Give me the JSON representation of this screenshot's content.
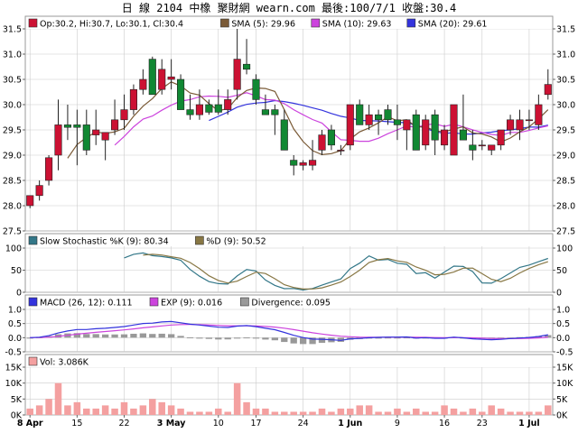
{
  "header": {
    "title_parts": [
      "日",
      "線",
      "2104",
      "中橡",
      "聚財網",
      "wearn.com",
      "最後:100/7/1",
      "收盤:30.4"
    ]
  },
  "colors": {
    "up": "#cc1133",
    "down": "#118833",
    "sma5": "#7a5a36",
    "sma10": "#cc44dd",
    "sma20": "#3333dd",
    "stoch_k": "#337788",
    "stoch_d": "#887744",
    "macd": "#3333dd",
    "exp": "#cc44dd",
    "divergence": "#999999",
    "volume": "#f4a0a0",
    "grid": "#cccccc"
  },
  "chart_data": [
    {
      "type": "candlestick",
      "legend": {
        "ohlc": "Op:30.2, Hi:30.7, Lo:30.1, Cl:30.4",
        "sma5": "SMA (5): 29.96",
        "sma10": "SMA (10): 29.63",
        "sma20": "SMA (20): 29.61"
      },
      "y_ticks": [
        "31.5",
        "31.0",
        "30.5",
        "30.0",
        "29.5",
        "29.0",
        "28.5",
        "28.0",
        "27.5"
      ],
      "ylim": [
        27.5,
        31.5
      ],
      "x_tick_labels": [
        {
          "label": "8 Apr",
          "idx": 0
        },
        {
          "label": "15",
          "idx": 5
        },
        {
          "label": "22",
          "idx": 10
        },
        {
          "label": "3 May",
          "idx": 15
        },
        {
          "label": "10",
          "idx": 20
        },
        {
          "label": "17",
          "idx": 24
        },
        {
          "label": "24",
          "idx": 29
        },
        {
          "label": "1 Jun",
          "idx": 34
        },
        {
          "label": "9",
          "idx": 39
        },
        {
          "label": "16",
          "idx": 44
        },
        {
          "label": "23",
          "idx": 48
        },
        {
          "label": "1 Jul",
          "idx": 53
        }
      ],
      "candles": [
        {
          "o": 28.0,
          "h": 28.2,
          "l": 27.95,
          "c": 28.2
        },
        {
          "o": 28.2,
          "h": 28.5,
          "l": 28.1,
          "c": 28.4
        },
        {
          "o": 28.5,
          "h": 29.0,
          "l": 28.4,
          "c": 28.95
        },
        {
          "o": 29.0,
          "h": 30.1,
          "l": 28.7,
          "c": 29.6
        },
        {
          "o": 29.6,
          "h": 30.0,
          "l": 29.3,
          "c": 29.55
        },
        {
          "o": 29.6,
          "h": 29.9,
          "l": 28.8,
          "c": 29.55
        },
        {
          "o": 29.6,
          "h": 29.9,
          "l": 29.0,
          "c": 29.1
        },
        {
          "o": 29.4,
          "h": 29.9,
          "l": 29.2,
          "c": 29.5
        },
        {
          "o": 29.3,
          "h": 29.4,
          "l": 28.9,
          "c": 29.45
        },
        {
          "o": 29.5,
          "h": 30.1,
          "l": 29.4,
          "c": 29.7
        },
        {
          "o": 29.7,
          "h": 30.2,
          "l": 29.5,
          "c": 29.9
        },
        {
          "o": 29.9,
          "h": 30.4,
          "l": 29.8,
          "c": 30.3
        },
        {
          "o": 30.3,
          "h": 30.7,
          "l": 30.2,
          "c": 30.5
        },
        {
          "o": 30.9,
          "h": 30.95,
          "l": 30.2,
          "c": 30.2
        },
        {
          "o": 30.3,
          "h": 30.9,
          "l": 30.2,
          "c": 30.7
        },
        {
          "o": 30.5,
          "h": 30.9,
          "l": 30.3,
          "c": 30.55
        },
        {
          "o": 30.5,
          "h": 30.6,
          "l": 29.9,
          "c": 29.9
        },
        {
          "o": 29.9,
          "h": 30.2,
          "l": 29.7,
          "c": 29.8
        },
        {
          "o": 29.8,
          "h": 30.3,
          "l": 29.7,
          "c": 30.0
        },
        {
          "o": 30.0,
          "h": 30.1,
          "l": 29.8,
          "c": 29.85
        },
        {
          "o": 30.0,
          "h": 30.3,
          "l": 29.8,
          "c": 29.85
        },
        {
          "o": 29.9,
          "h": 30.3,
          "l": 29.8,
          "c": 30.1
        },
        {
          "o": 30.3,
          "h": 31.5,
          "l": 30.1,
          "c": 30.9
        },
        {
          "o": 30.8,
          "h": 31.3,
          "l": 30.6,
          "c": 30.7
        },
        {
          "o": 30.5,
          "h": 30.6,
          "l": 30.0,
          "c": 30.1
        },
        {
          "o": 29.9,
          "h": 30.2,
          "l": 29.8,
          "c": 29.8
        },
        {
          "o": 29.9,
          "h": 30.0,
          "l": 29.4,
          "c": 29.8
        },
        {
          "o": 29.7,
          "h": 29.9,
          "l": 29.1,
          "c": 29.1
        },
        {
          "o": 28.9,
          "h": 29.0,
          "l": 28.6,
          "c": 28.8
        },
        {
          "o": 28.8,
          "h": 28.9,
          "l": 28.7,
          "c": 28.85
        },
        {
          "o": 28.8,
          "h": 29.3,
          "l": 28.7,
          "c": 28.9
        },
        {
          "o": 29.1,
          "h": 29.5,
          "l": 29.0,
          "c": 29.4
        },
        {
          "o": 29.5,
          "h": 29.6,
          "l": 29.1,
          "c": 29.2
        },
        {
          "o": 29.1,
          "h": 29.2,
          "l": 29.0,
          "c": 29.1
        },
        {
          "o": 29.2,
          "h": 30.0,
          "l": 29.1,
          "c": 30.0
        },
        {
          "o": 30.0,
          "h": 30.1,
          "l": 29.6,
          "c": 29.6
        },
        {
          "o": 29.6,
          "h": 30.0,
          "l": 29.5,
          "c": 29.8
        },
        {
          "o": 29.8,
          "h": 29.9,
          "l": 29.4,
          "c": 29.7
        },
        {
          "o": 29.9,
          "h": 30.0,
          "l": 29.6,
          "c": 29.7
        },
        {
          "o": 29.7,
          "h": 30.0,
          "l": 29.3,
          "c": 29.6
        },
        {
          "o": 29.5,
          "h": 29.7,
          "l": 29.1,
          "c": 29.7
        },
        {
          "o": 29.8,
          "h": 29.9,
          "l": 29.1,
          "c": 29.1
        },
        {
          "o": 29.2,
          "h": 29.8,
          "l": 29.1,
          "c": 29.7
        },
        {
          "o": 29.8,
          "h": 29.9,
          "l": 29.0,
          "c": 29.3
        },
        {
          "o": 29.2,
          "h": 29.6,
          "l": 29.1,
          "c": 29.5
        },
        {
          "o": 29.0,
          "h": 30.0,
          "l": 29.0,
          "c": 30.0
        },
        {
          "o": 29.5,
          "h": 30.2,
          "l": 29.3,
          "c": 29.3
        },
        {
          "o": 29.2,
          "h": 29.5,
          "l": 28.9,
          "c": 29.1
        },
        {
          "o": 29.2,
          "h": 29.3,
          "l": 29.1,
          "c": 29.2
        },
        {
          "o": 29.1,
          "h": 29.2,
          "l": 29.0,
          "c": 29.2
        },
        {
          "o": 29.2,
          "h": 29.5,
          "l": 29.1,
          "c": 29.5
        },
        {
          "o": 29.5,
          "h": 29.8,
          "l": 29.4,
          "c": 29.7
        },
        {
          "o": 29.5,
          "h": 29.9,
          "l": 29.3,
          "c": 29.7
        },
        {
          "o": 29.7,
          "h": 29.9,
          "l": 29.5,
          "c": 29.7
        },
        {
          "o": 29.6,
          "h": 30.2,
          "l": 29.5,
          "c": 30.0
        },
        {
          "o": 30.2,
          "h": 30.7,
          "l": 30.1,
          "c": 30.4
        }
      ]
    },
    {
      "type": "line",
      "legend": {
        "k": "Slow Stochastic %K (9): 80.34",
        "d": "%D (9): 50.52"
      },
      "y_ticks": [
        "100",
        "50",
        "0"
      ],
      "ylim": [
        0,
        100
      ]
    },
    {
      "type": "line",
      "legend": {
        "macd": "MACD (26, 12): 0.111",
        "exp": "EXP (9): 0.016",
        "divergence": "Divergence: 0.095"
      },
      "y_ticks": [
        "1.0",
        "0.5",
        "0.0",
        "-0.5"
      ],
      "ylim": [
        -0.5,
        1.0
      ]
    },
    {
      "type": "bar",
      "legend": {
        "vol": "Vol: 3.086K"
      },
      "y_ticks": [
        "15K",
        "10K",
        "5K",
        "0K"
      ],
      "ylim": [
        0,
        15
      ],
      "values": [
        2,
        3,
        5,
        10,
        3,
        4,
        2,
        2,
        3,
        2,
        4,
        2,
        3,
        5,
        4,
        3,
        2,
        1,
        1,
        1,
        2,
        1,
        10,
        4,
        2,
        2,
        1,
        1,
        1,
        1,
        1,
        2,
        1,
        2,
        2,
        3,
        3,
        1,
        1,
        2,
        1,
        2,
        1,
        1,
        3,
        2,
        1,
        2,
        1,
        3,
        2,
        1,
        1,
        1,
        1,
        3
      ]
    }
  ]
}
